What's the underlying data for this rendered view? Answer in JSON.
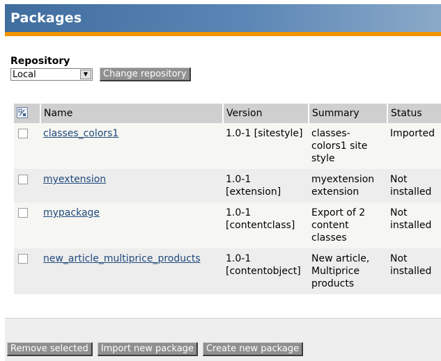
{
  "header": {
    "title": "Packages"
  },
  "repository": {
    "label": "Repository",
    "selected": "Local",
    "change_button": "Change repository"
  },
  "table": {
    "columns": [
      "Name",
      "Version",
      "Summary",
      "Status"
    ],
    "rows": [
      {
        "name": "classes_colors1",
        "version": "1.0-1 [sitestyle]",
        "summary": "classes-colors1 site style",
        "status": "Imported"
      },
      {
        "name": "myextension",
        "version": "1.0-1 [extension]",
        "summary": "myextension extension",
        "status": "Not installed"
      },
      {
        "name": "mypackage",
        "version": "1.0-1 [contentclass]",
        "summary": "Export of 2 content classes",
        "status": "Not installed"
      },
      {
        "name": "new_article_multiprice_products",
        "version": "1.0-1 [contentobject]",
        "summary": "New article, Multiprice products",
        "status": "Not installed"
      }
    ]
  },
  "actions": {
    "remove": "Remove selected",
    "import": "Import new package",
    "create": "Create new package"
  },
  "colors": {
    "header_bg": "#4f7aa9",
    "accent_bar": "#f29400",
    "link": "#20497c",
    "button_bg": "#8f8f8f"
  },
  "icons": {
    "select_all": "invert-selection-icon",
    "dropdown": "dropdown-arrow-icon"
  }
}
